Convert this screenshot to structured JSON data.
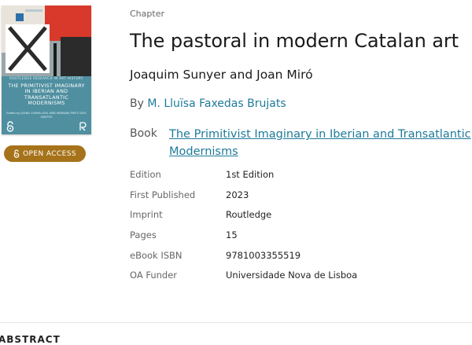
{
  "cover": {
    "series": "ROUTLEDGE RESEARCH IN ART HISTORY",
    "title": "THE PRIMITIVIST IMAGINARY IN IBERIAN AND TRANSATLANTIC MODERNISMS",
    "editors": "Edited by JOANA CUNHA LEAL AND MARIANA PINTO DOS SANTOS",
    "colors": {
      "background": "#4f8fa0",
      "red": "#d8392b",
      "dark": "#2b2b2b"
    }
  },
  "badge": {
    "label": "OPEN ACCESS",
    "icon": "lock-open-icon",
    "color": "#a6731a"
  },
  "header": {
    "kicker": "Chapter",
    "title": "The pastoral in modern Catalan art",
    "subtitle": "Joaquim Sunyer and Joan Miró",
    "by_label": "By",
    "author": "M. Lluïsa Faxedas Brujats"
  },
  "book": {
    "label": "Book",
    "title": "The Primitivist Imaginary in Iberian and Transatlantic Modernisms"
  },
  "meta": [
    {
      "key": "Edition",
      "value": "1st Edition"
    },
    {
      "key": "First Published",
      "value": "2023"
    },
    {
      "key": "Imprint",
      "value": "Routledge"
    },
    {
      "key": "Pages",
      "value": "15"
    },
    {
      "key": "eBook ISBN",
      "value": "9781003355519"
    },
    {
      "key": "OA Funder",
      "value": "Universidade Nova de Lisboa"
    }
  ],
  "abstract_heading": "ABSTRACT",
  "link_color": "#1e7a99"
}
